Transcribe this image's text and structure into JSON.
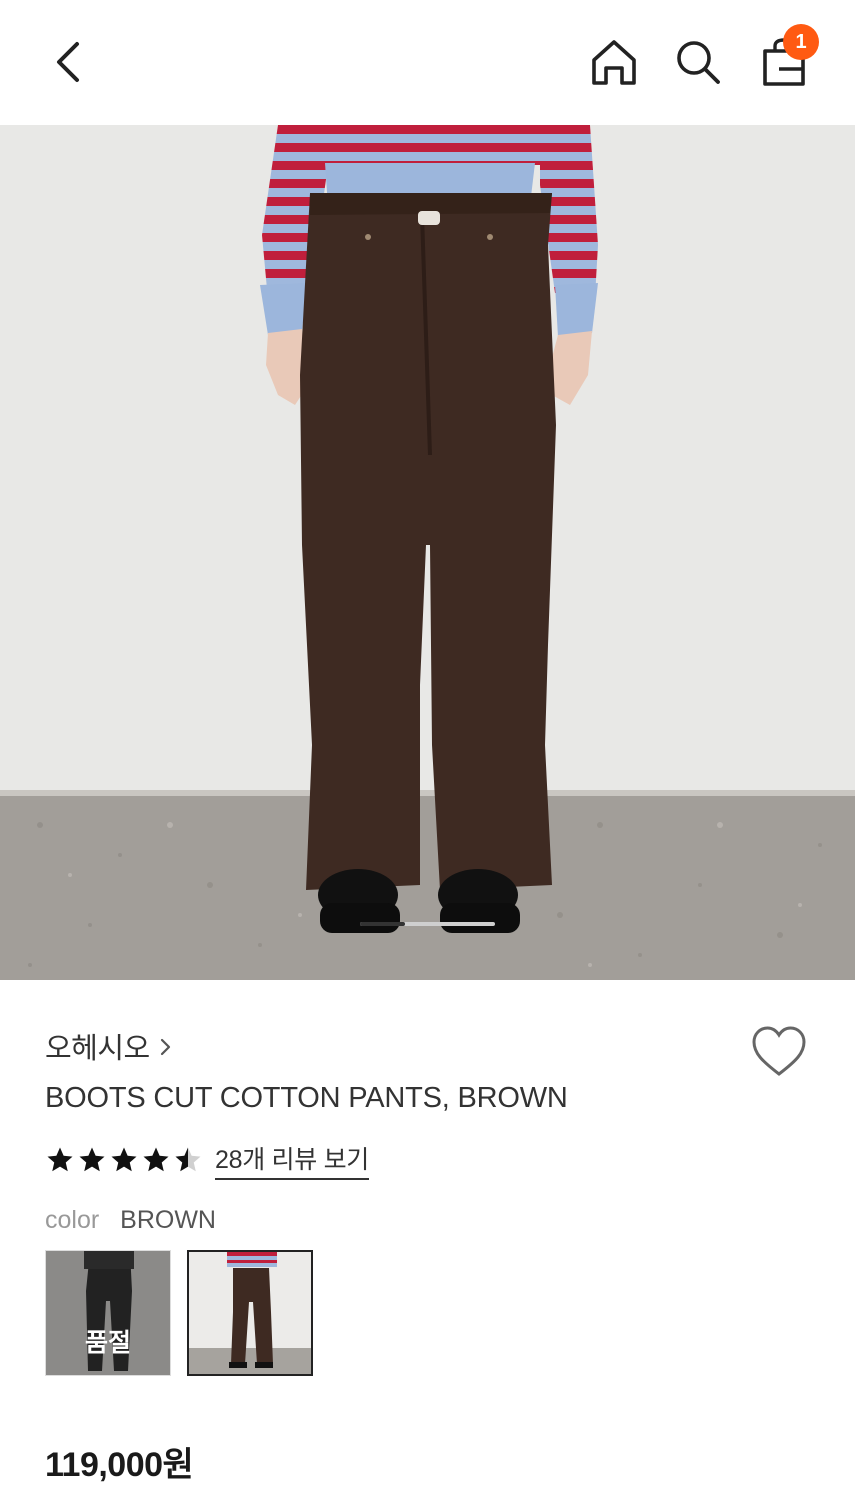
{
  "header": {
    "back_icon": "chevron-left-icon",
    "home_icon": "home-icon",
    "search_icon": "search-icon",
    "cart_icon": "shopping-bag-icon",
    "cart_count": "1",
    "badge_color": "#ff5a12"
  },
  "gallery": {
    "image_subject": "model wearing brown boots cut pants with striped sweater",
    "current_slide": 1,
    "total_slides": 3
  },
  "product": {
    "brand": "오헤시오",
    "title": "BOOTS CUT COTTON PANTS, BROWN",
    "rating": 4.5,
    "review_link": "28개 리뷰 보기",
    "color_label": "color",
    "color_value": "BROWN",
    "options": [
      {
        "name": "BLACK",
        "status": "품절"
      },
      {
        "name": "BROWN",
        "status": ""
      }
    ],
    "price": "119,000원"
  },
  "colors": {
    "text_primary": "#333333",
    "text_muted": "#999999",
    "pants_brown": "#3e2a22"
  }
}
